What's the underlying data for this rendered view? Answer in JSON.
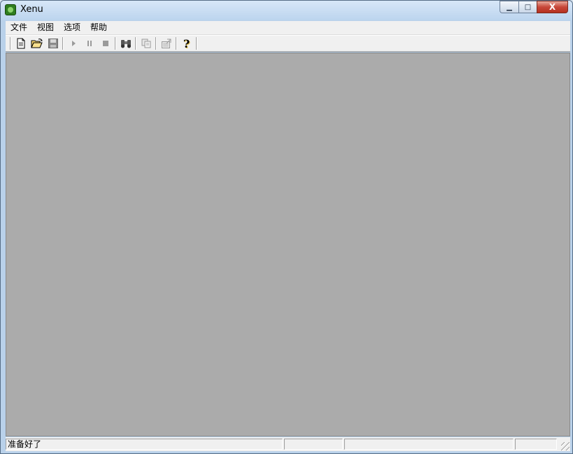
{
  "window": {
    "title": "Xenu",
    "minimize_glyph": "▁",
    "maximize_glyph": "□",
    "close_glyph": "X"
  },
  "menu": {
    "items": [
      "文件",
      "视图",
      "选项",
      "帮助"
    ]
  },
  "toolbar": {
    "buttons": [
      {
        "icon": "new-document-icon"
      },
      {
        "icon": "open-folder-icon"
      },
      {
        "icon": "save-icon"
      },
      {
        "icon": "play-icon"
      },
      {
        "icon": "pause-icon"
      },
      {
        "icon": "stop-icon"
      },
      {
        "icon": "binoculars-icon"
      },
      {
        "icon": "copy-icon"
      },
      {
        "icon": "properties-icon"
      },
      {
        "icon": "help-icon"
      }
    ],
    "help_glyph": "?"
  },
  "status": {
    "text": "准备好了",
    "pane2": "",
    "pane3": "",
    "pane4": ""
  },
  "colors": {
    "client_background": "#ababab",
    "chrome": "#f0f0f0"
  }
}
